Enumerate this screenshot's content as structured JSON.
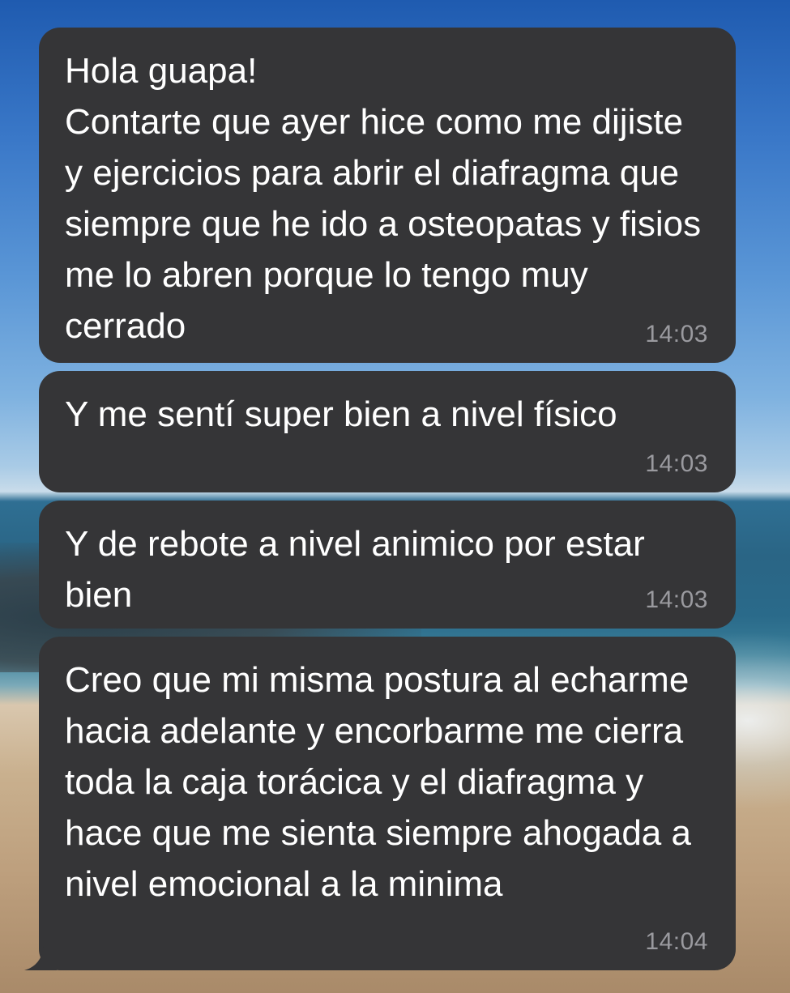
{
  "conversation": {
    "messages": [
      {
        "text": "Hola guapa!\nContarte que ayer hice como me dijiste y ejercicios para abrir el diafragma que siempre que he ido a osteopatas y fisios me lo abren porque lo tengo muy cerrado",
        "time": "14:03"
      },
      {
        "text": "Y me sentí super bien a nivel físico",
        "time": "14:03"
      },
      {
        "text": "Y de rebote a nivel animico por estar bien",
        "time": "14:03"
      },
      {
        "text": "Creo que mi misma postura al echarme hacia adelante y encorbarme me cierra toda la caja torácica y el diafragma y hace que me sienta siempre ahogada a nivel emocional a la minima",
        "time": "14:04"
      }
    ]
  },
  "colors": {
    "bubble": "#353537",
    "text": "#ffffff",
    "timestamp": "#9a9a9f"
  }
}
